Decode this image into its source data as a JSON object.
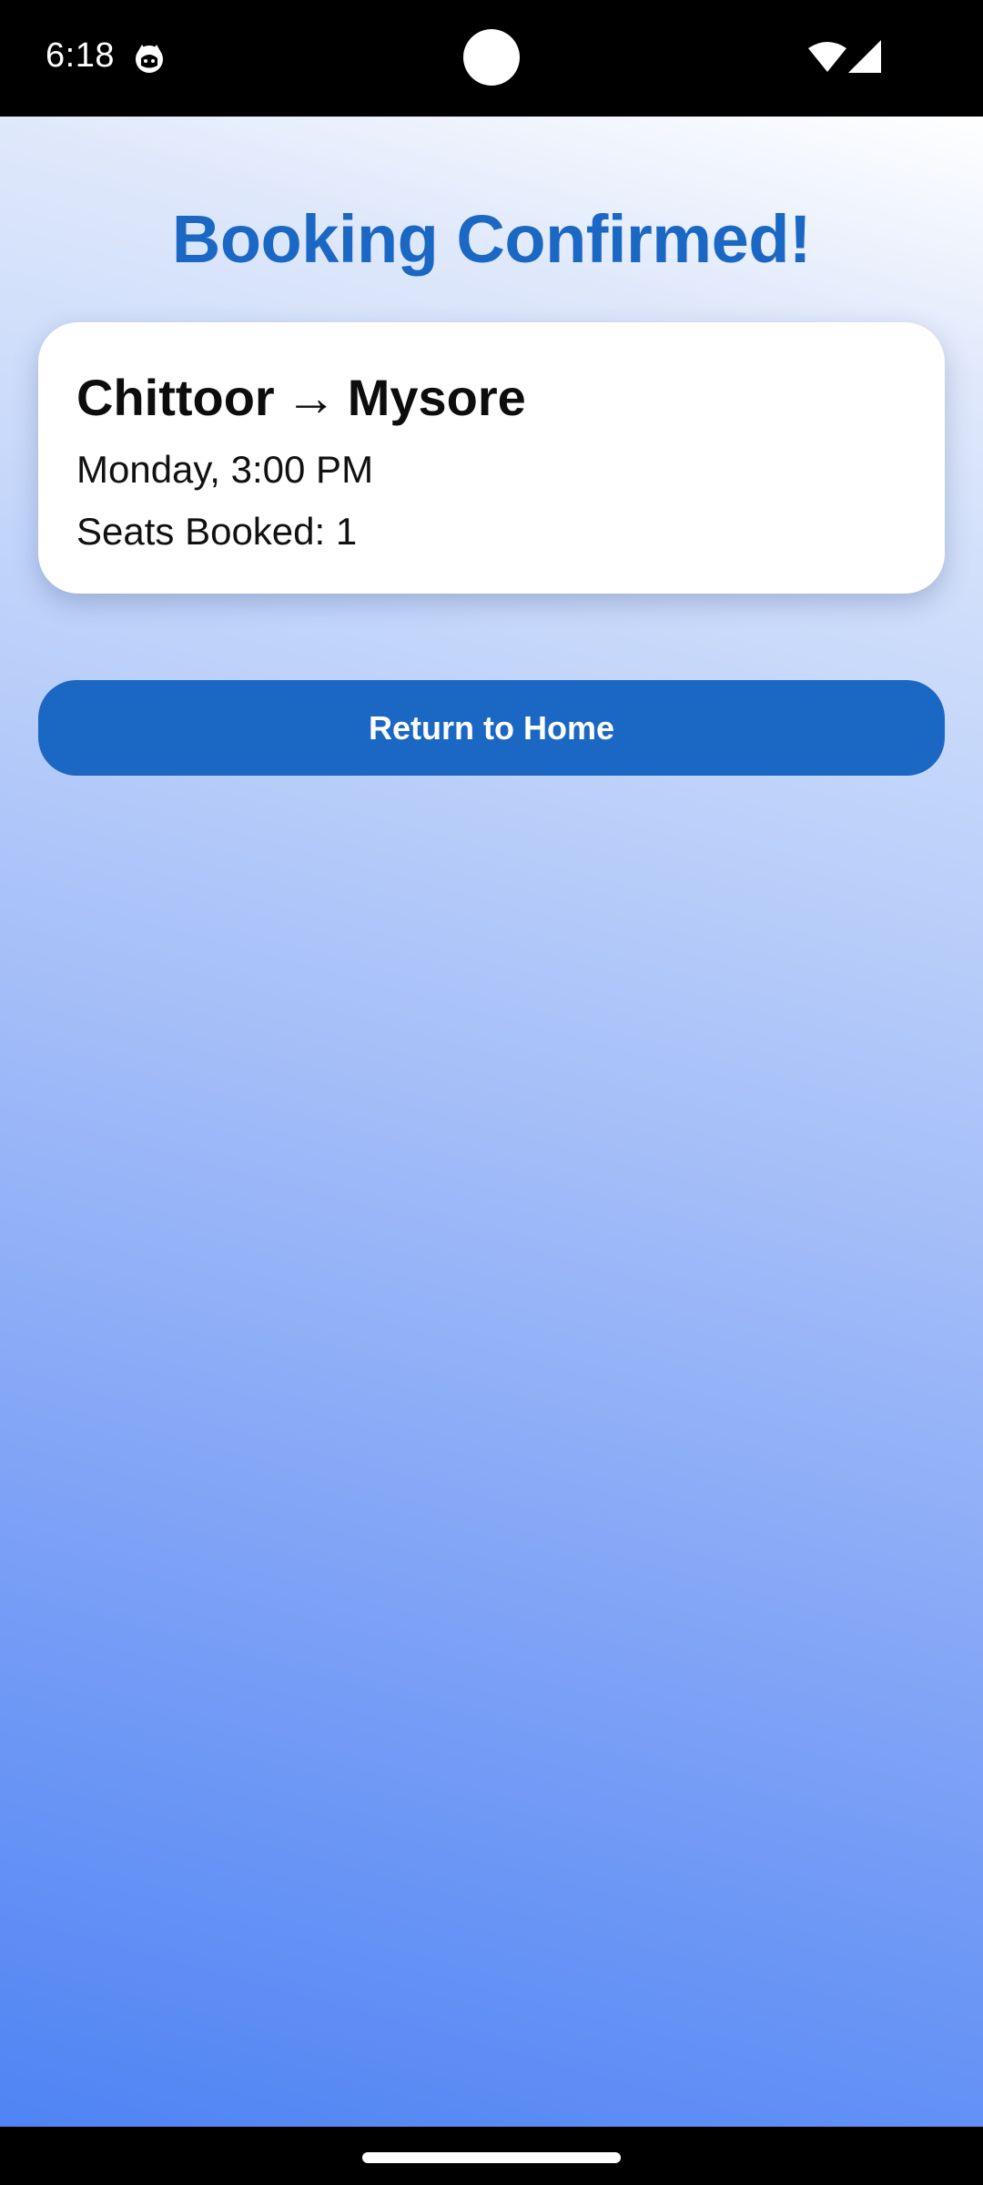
{
  "status_bar": {
    "time": "6:18",
    "app_icon": "cat-face-icon",
    "wifi_icon": "wifi-icon",
    "signal_icon": "cell-signal-icon"
  },
  "page": {
    "title": "Booking Confirmed!"
  },
  "booking": {
    "origin": "Chittoor",
    "arrow": "→",
    "destination": "Mysore",
    "schedule": "Monday, 3:00 PM",
    "seats_text": "Seats Booked: 1"
  },
  "actions": {
    "return_home_label": "Return to Home"
  },
  "colors": {
    "accent": "#1b68c4",
    "card_bg": "#ffffff",
    "gradient_top": "#ffffff",
    "gradient_bottom": "#4f84f4"
  }
}
